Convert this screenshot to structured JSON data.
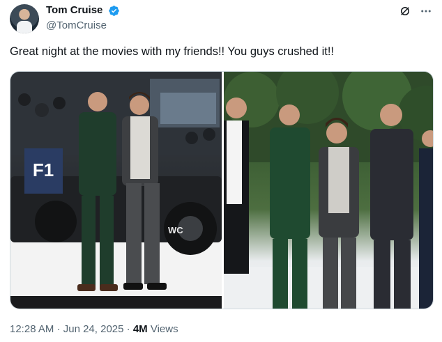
{
  "author": {
    "display_name": "Tom Cruise",
    "handle": "@TomCruise",
    "verified_icon": "verified-badge-icon"
  },
  "actions": {
    "grok_icon": "grok-icon",
    "more_icon": "more-options-icon"
  },
  "tweet": {
    "text": "Great night at the movies with my friends!! You guys crushed it!!"
  },
  "media": {
    "photos": [
      {
        "alt": "Two men in suits standing in front of a Formula 1 race car at a premiere"
      },
      {
        "alt": "Five men in suits posing outdoors in front of trees at a premiere"
      }
    ],
    "car_logo_text": "F1",
    "car_number_text": "WC"
  },
  "meta": {
    "time": "12:28 AM",
    "separator1": "·",
    "date": "Jun 24, 2025",
    "separator2": "·",
    "views_count": "4M",
    "views_label": "Views"
  },
  "colors": {
    "verified_blue": "#1d9bf0",
    "secondary_text": "#536471",
    "primary_text": "#0f1419",
    "border": "#cfd9de"
  }
}
